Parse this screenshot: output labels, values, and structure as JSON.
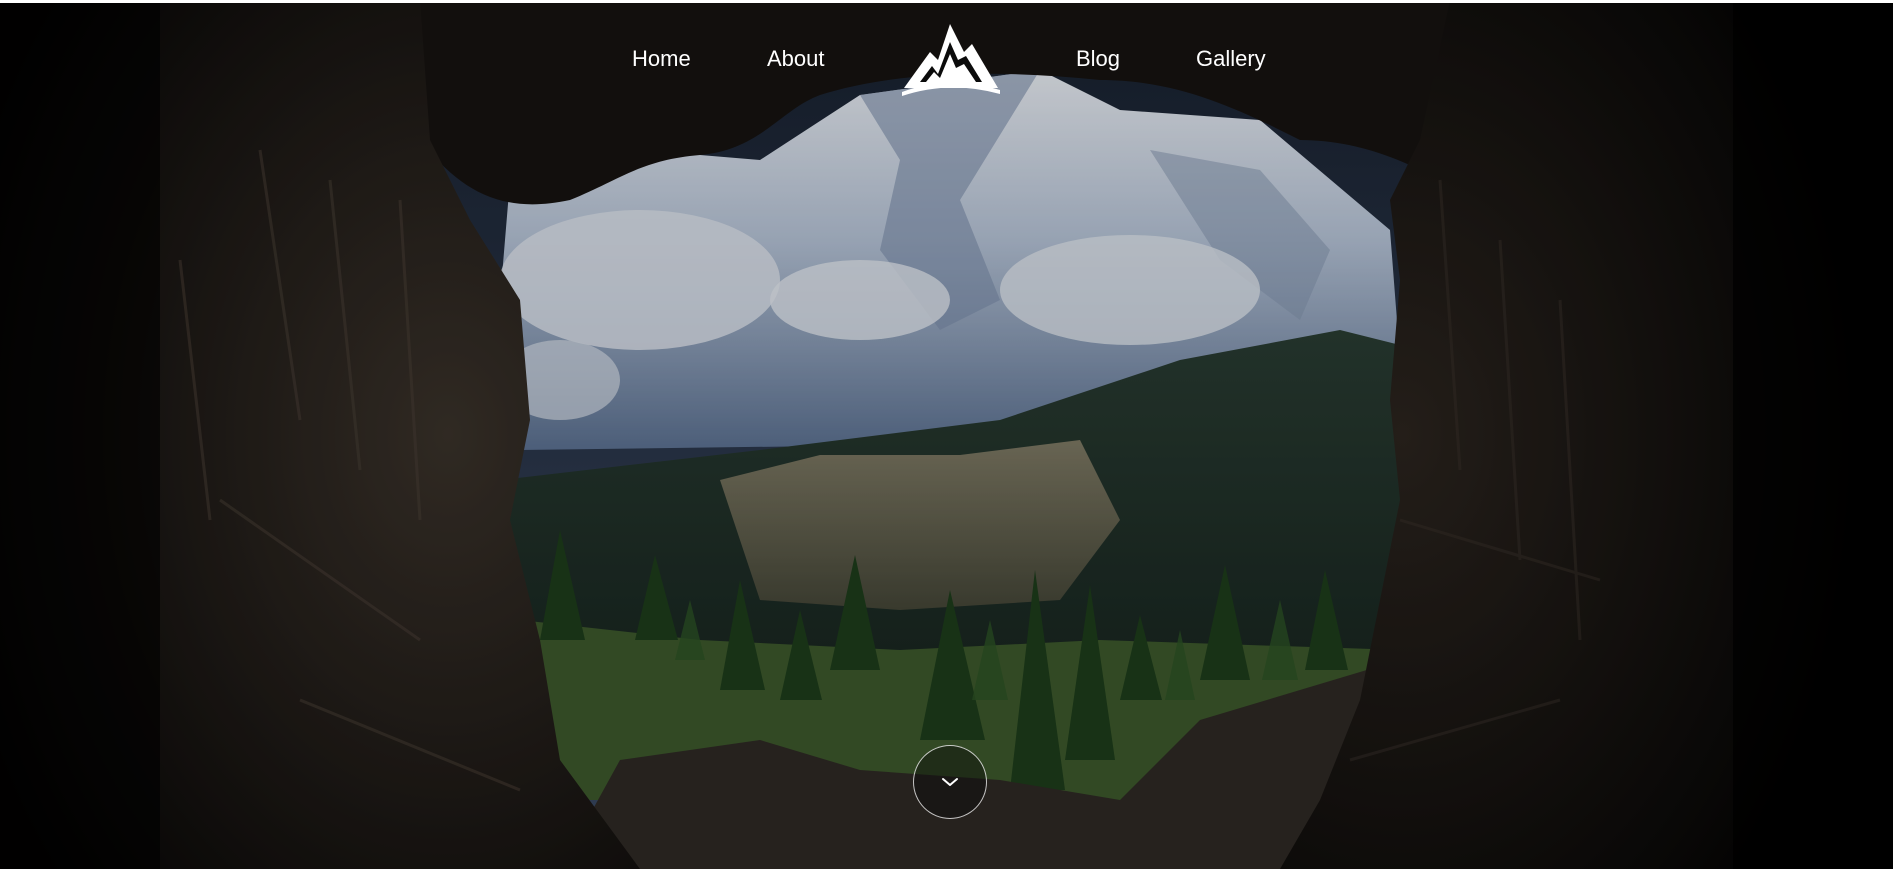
{
  "nav": {
    "items": [
      {
        "label": "Home"
      },
      {
        "label": "About"
      },
      {
        "label": "Blog"
      },
      {
        "label": "Gallery"
      }
    ]
  },
  "logo": {
    "icon": "mountain-logo-icon"
  },
  "scroll_button": {
    "icon": "chevron-down-icon"
  },
  "colors": {
    "nav_text": "#ffffff",
    "background": "#000000",
    "sky": "#c9d3df",
    "snow": "#e9eef5",
    "forest": "#1f3a2a",
    "rock": "#2b2520"
  }
}
